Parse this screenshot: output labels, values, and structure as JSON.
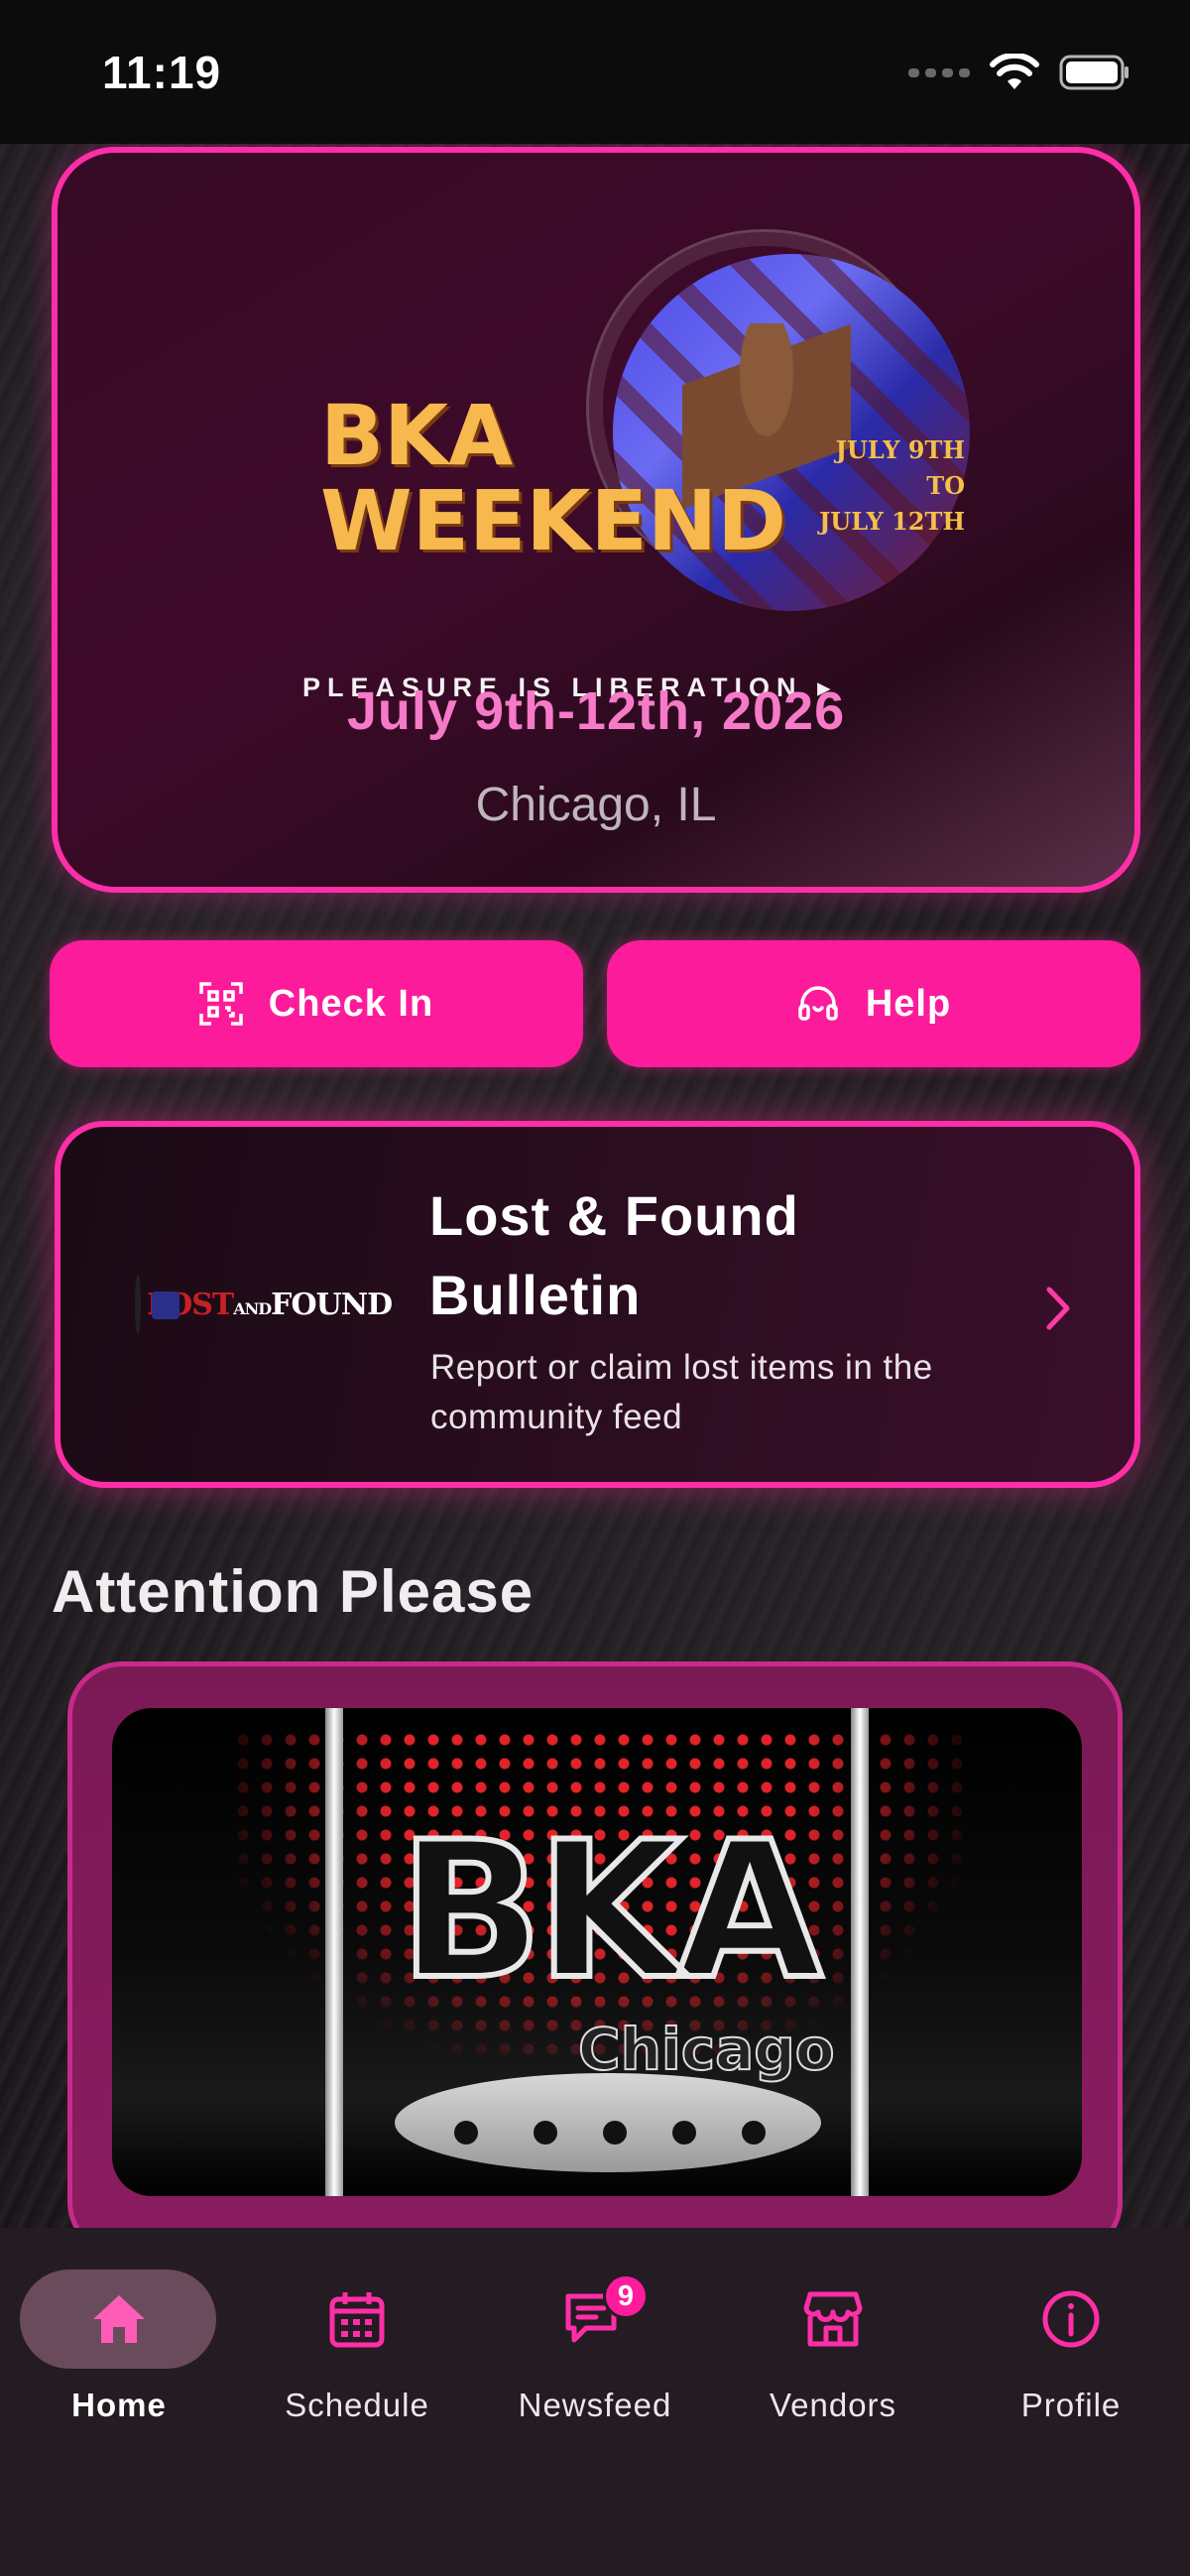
{
  "status_bar": {
    "time": "11:19"
  },
  "event": {
    "logo_title_line1": "BKA",
    "logo_title_line2": "WEEKEND",
    "logo_subtitle": "PLEASURE IS LIBERATION",
    "poster_date_line1": "JULY 9TH TO",
    "poster_date_line2": "JULY 12TH",
    "date": "July 9th-12th, 2026",
    "location": "Chicago, IL"
  },
  "actions": {
    "check_in_label": "Check In",
    "help_label": "Help"
  },
  "lost_found": {
    "logo_text_1": "LOST",
    "logo_text_2": "AND",
    "logo_text_3": "FOUND",
    "title": "Lost & Found Bulletin",
    "description": "Report or claim lost items in the community feed"
  },
  "attention": {
    "section_title": "Attention Please",
    "banner_title": "BKA",
    "banner_subtitle": "Chicago"
  },
  "tabs": [
    {
      "label": "Home",
      "icon": "home-icon",
      "active": true
    },
    {
      "label": "Schedule",
      "icon": "calendar-icon",
      "active": false
    },
    {
      "label": "Newsfeed",
      "icon": "chat-icon",
      "active": false,
      "badge": "9"
    },
    {
      "label": "Vendors",
      "icon": "store-icon",
      "active": false
    },
    {
      "label": "Profile",
      "icon": "info-icon",
      "active": false
    }
  ],
  "colors": {
    "accent": "#fc1c9b",
    "date_pink": "#f67ac8",
    "logo_gold": "#f7b84e",
    "tab_bar": "#241c22"
  }
}
